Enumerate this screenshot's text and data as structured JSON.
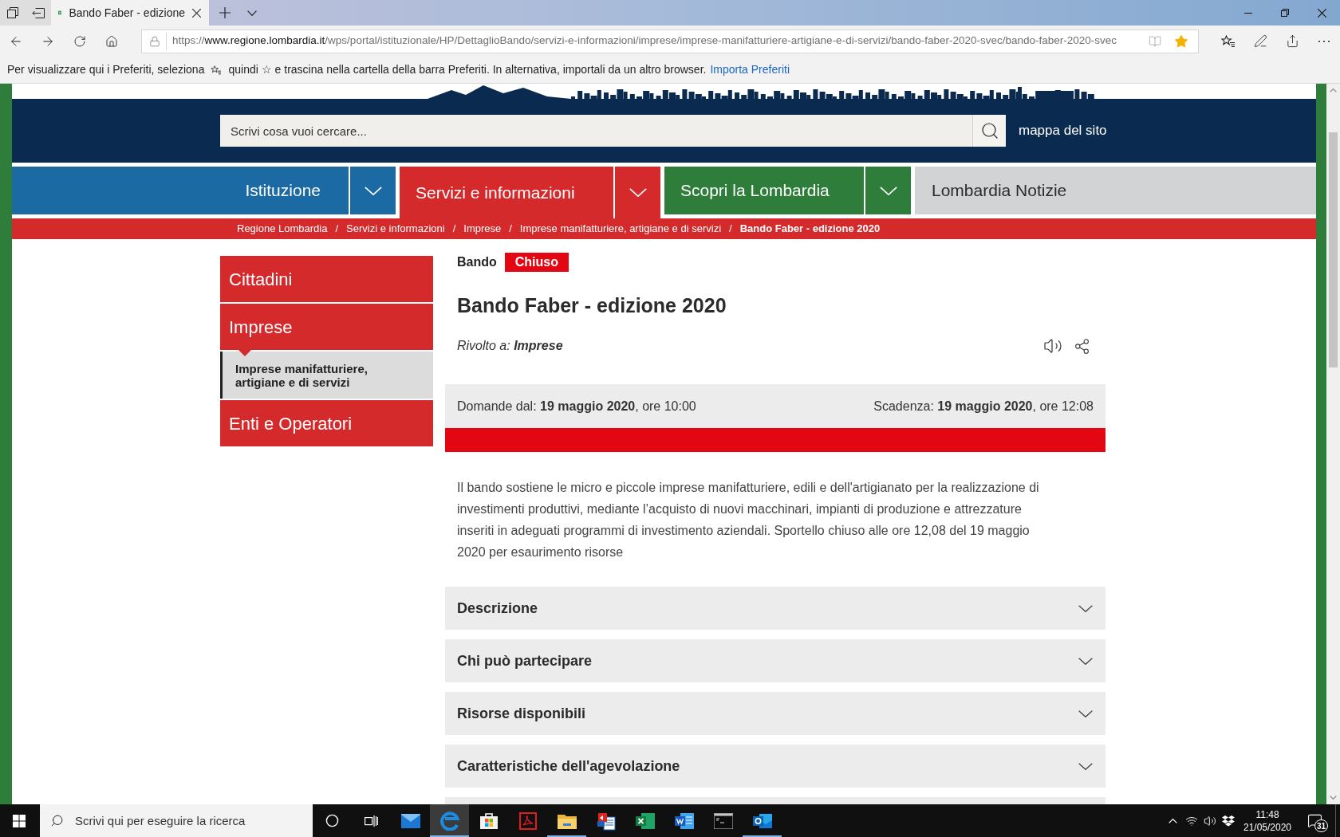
{
  "browser": {
    "tab": {
      "title": "Bando Faber - edizione"
    },
    "address": {
      "scheme": "https://",
      "host": "www.regione.lombardia.it",
      "path": "/wps/portal/istituzionale/HP/DettaglioBando/servizi-e-informazioni/imprese/imprese-manifatturiere-artigiane-e-di-servizi/bando-faber-2020-svec/bando-faber-2020-svec",
      "favorite": true
    },
    "favorites_bar": {
      "text_before": "Per visualizzare qui i Preferiti, seleziona",
      "text_after": "quindi ☆ e trascina nella cartella della barra Preferiti. In alternativa, importali da un altro browser.",
      "link": "Importa Preferiti"
    }
  },
  "header": {
    "search": {
      "placeholder": "Scrivi cosa vuoi cercare..."
    },
    "sitemap_link": "mappa del sito"
  },
  "nav": {
    "items": [
      {
        "label": "Istituzione",
        "color": "#1c6aa3",
        "dropdown": true,
        "selected": false
      },
      {
        "label": "Servizi e informazioni",
        "color": "#d42a2c",
        "dropdown": true,
        "selected": true
      },
      {
        "label": "Scopri la Lombardia",
        "color": "#2e7d3a",
        "dropdown": true,
        "selected": false
      },
      {
        "label": "Lombardia Notizie",
        "color": "#d1d3d4",
        "dropdown": false,
        "selected": false
      }
    ]
  },
  "breadcrumb": [
    {
      "label": "Regione Lombardia",
      "current": false
    },
    {
      "separator": "/",
      "label": "Servizi e informazioni",
      "current": false
    },
    {
      "separator": "/",
      "label": "Imprese",
      "current": false
    },
    {
      "separator": "/",
      "label": "Imprese manifatturiere, artigiane e di servizi",
      "current": false
    },
    {
      "separator": "/",
      "label": "Bando Faber - edizione 2020",
      "current": true
    }
  ],
  "sidebar": {
    "items": [
      {
        "label": "Cittadini",
        "selected": false
      },
      {
        "label": "Imprese",
        "selected": true,
        "children": [
          {
            "label": "Imprese manifatturiere, artigiane e di servizi",
            "selected": true
          }
        ]
      },
      {
        "label": "Enti e Operatori",
        "selected": false
      }
    ]
  },
  "bando": {
    "type_label": "Bando",
    "status": {
      "label": "Chiuso",
      "closed": true
    },
    "title": "Bando Faber - edizione 2020",
    "audience": {
      "label": "Rivolto a:",
      "value": "Imprese"
    },
    "dates": {
      "opening": "Domande dal: **19 maggio 2020**, ore 10:00",
      "deadline": "Scadenza: **19 maggio 2020**, ore 12:08"
    },
    "summary": "Il bando sostiene le micro e piccole imprese manifatturiere, edili e dell'artigianato per la realizzazione di investimenti produttivi, mediante l’acquisto di nuovi macchinari, impianti di produzione e attrezzature inseriti in adeguati programmi di investimento aziendali. Sportello chiuso alle ore 12,08 del 19 maggio 2020 per esaurimento risorse",
    "accordions": [
      {
        "title": "Descrizione",
        "expanded": false
      },
      {
        "title": "Chi può partecipare",
        "expanded": false
      },
      {
        "title": "Risorse disponibili",
        "expanded": false
      },
      {
        "title": "Caratteristiche dell'agevolazione",
        "expanded": false
      }
    ],
    "more_below": true
  },
  "taskbar": {
    "search": {
      "placeholder": "Scrivi qui per eseguire la ricerca"
    },
    "apps": [
      {
        "kind": "mail",
        "running": false,
        "active": false
      },
      {
        "kind": "browser",
        "running": true,
        "active": true
      },
      {
        "kind": "store",
        "running": false,
        "active": false
      },
      {
        "kind": "pdf",
        "running": false,
        "active": false
      },
      {
        "kind": "folder",
        "running": true,
        "active": false
      },
      {
        "kind": "remote",
        "running": false,
        "active": false
      },
      {
        "kind": "spreadsheet",
        "running": false,
        "active": false
      },
      {
        "kind": "document",
        "running": false,
        "active": false
      },
      {
        "kind": "terminal",
        "running": false,
        "active": false
      },
      {
        "kind": "email",
        "running": true,
        "active": false
      }
    ],
    "clock": {
      "time": "11:48",
      "date": "21/05/2020"
    },
    "notifications": {
      "count": "31"
    }
  }
}
